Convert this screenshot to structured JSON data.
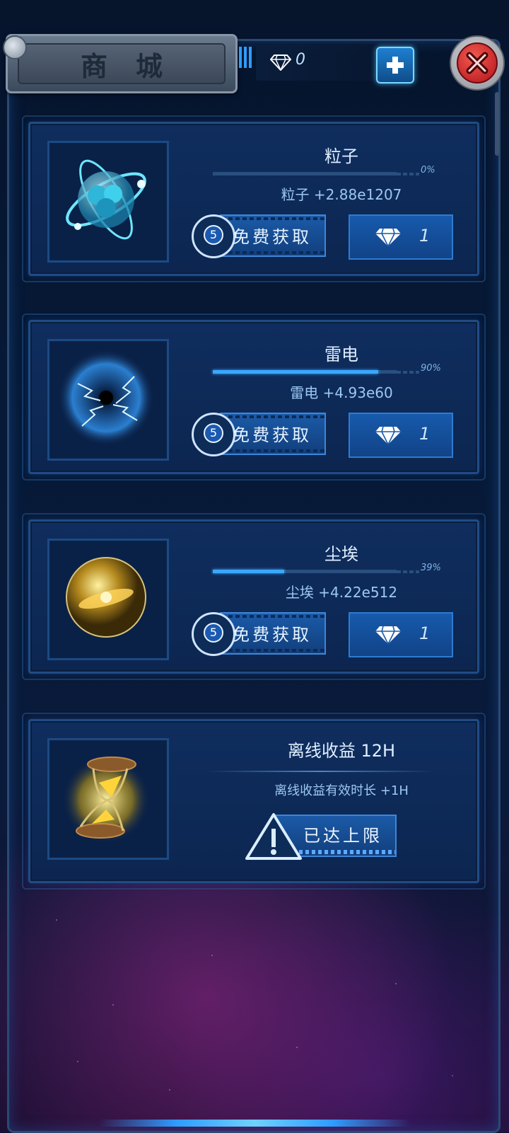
{
  "header": {
    "title": "商城",
    "diamond_count": "0"
  },
  "items": [
    {
      "name": "粒子",
      "progress_label": "0%",
      "progress": 0.0,
      "gain": "粒子  +2.88e1207",
      "ad_count": "5",
      "free_label": "免费获取",
      "price": "1",
      "icon": "atom-icon"
    },
    {
      "name": "雷电",
      "progress_label": "90%",
      "progress": 0.9,
      "gain": "雷电  +4.93e60",
      "ad_count": "5",
      "free_label": "免费获取",
      "price": "1",
      "icon": "lightning-orb-icon"
    },
    {
      "name": "尘埃",
      "progress_label": "39%",
      "progress": 0.39,
      "gain": "尘埃  +4.22e512",
      "ad_count": "5",
      "free_label": "免费获取",
      "price": "1",
      "icon": "dust-orb-icon"
    }
  ],
  "offline": {
    "name": "离线收益 12H",
    "desc": "离线收益有效时长 +1H",
    "status": "已达上限",
    "icon": "hourglass-icon"
  },
  "colors": {
    "accent": "#3aa7ff",
    "card_bg": "#0f2d5e",
    "close_red": "#d3202a"
  }
}
